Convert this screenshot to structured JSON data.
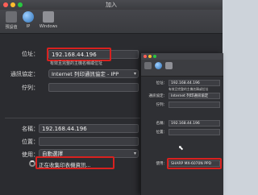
{
  "window": {
    "title": "加入"
  },
  "toolbar": {
    "items": [
      {
        "label": "預設值",
        "icon": "default-printer-icon"
      },
      {
        "label": "IP",
        "icon": "ip-globe-icon"
      },
      {
        "label": "Windows",
        "icon": "windows-printer-icon"
      }
    ]
  },
  "form": {
    "address_label": "位址：",
    "address_value": "192.168.44.196",
    "address_hint": "有效且完整的主機名稱或位址",
    "protocol_label": "通訊協定：",
    "protocol_value": "Internet 列印通訊協定 - IPP",
    "queue_label": "佇列：",
    "queue_value": "",
    "name_label": "名稱：",
    "name_value": "192.168.44.196",
    "location_label": "位置：",
    "location_value": "",
    "use_label": "使用：",
    "use_value": "自動選擇",
    "status_text": "正在收集印表機資訊..."
  },
  "second_window": {
    "address_label": "位址：",
    "address_value": "192.168.44.196",
    "address_hint": "有效且完整的主機名稱或位址",
    "protocol_label": "通訊協定：",
    "protocol_value": "Internet 列印通訊協定",
    "queue_label": "佇列：",
    "name_label": "名稱：",
    "name_value": "192.168.44.196",
    "location_label": "位置：",
    "use_label": "使用：",
    "use_value": "SHARP MX-6070N PPD"
  },
  "colors": {
    "highlight": "#d8211f",
    "window_bg": "#2b2c30",
    "traffic_red": "#ff5f57",
    "traffic_yellow": "#febc2e",
    "traffic_green": "#28c840"
  }
}
